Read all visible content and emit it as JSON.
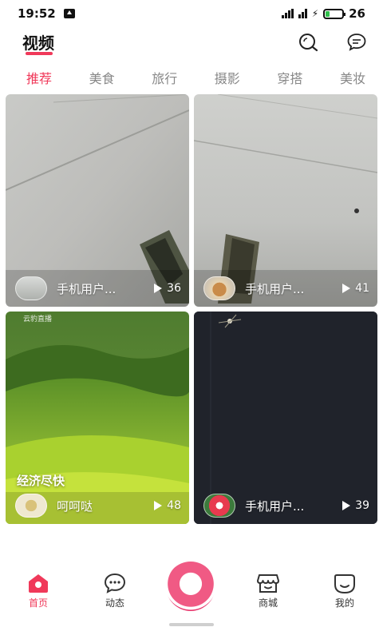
{
  "status_bar": {
    "time": "19:52",
    "battery": "26",
    "battery_level": 0.26
  },
  "header": {
    "title": "视频",
    "search_icon": "search-icon",
    "message_icon": "message-icon"
  },
  "tabs": [
    {
      "label": "推荐",
      "active": true
    },
    {
      "label": "美食",
      "active": false
    },
    {
      "label": "旅行",
      "active": false
    },
    {
      "label": "摄影",
      "active": false
    },
    {
      "label": "穿搭",
      "active": false
    },
    {
      "label": "美妆",
      "active": false
    }
  ],
  "videos": [
    {
      "author": "手机用户...",
      "plays": "36",
      "caption": ""
    },
    {
      "author": "手机用户...",
      "plays": "41",
      "caption": ""
    },
    {
      "author": "呵呵哒",
      "plays": "48",
      "caption": "经济尽快",
      "tag": "云豹直播"
    },
    {
      "author": "手机用户...",
      "plays": "39",
      "caption": ""
    }
  ],
  "bottom_nav": [
    {
      "label": "首页",
      "icon": "home-icon",
      "active": true
    },
    {
      "label": "动态",
      "icon": "chat-bubble-icon",
      "active": false
    },
    {
      "label": "商城",
      "icon": "store-icon",
      "active": false
    },
    {
      "label": "我的",
      "icon": "profile-icon",
      "active": false
    }
  ],
  "colors": {
    "accent": "#f0395a",
    "tab_inactive": "#888888"
  }
}
